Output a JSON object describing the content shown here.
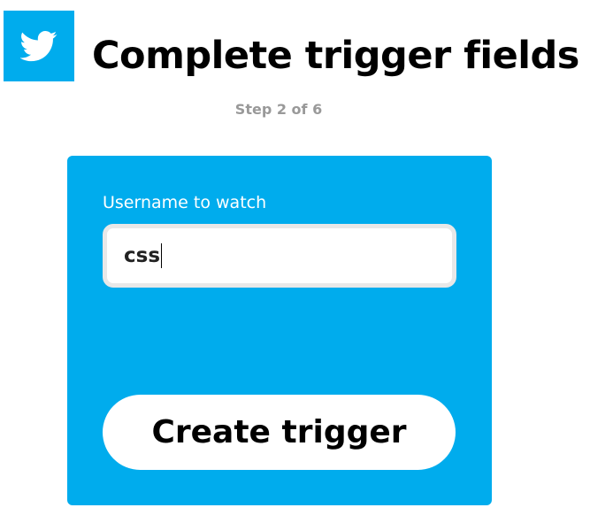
{
  "header": {
    "service_icon": "twitter-bird-icon",
    "title": "Complete trigger fields",
    "step": "Step 2 of 6"
  },
  "form": {
    "field_label": "Username to watch",
    "field_value": "css",
    "submit_label": "Create trigger"
  },
  "colors": {
    "brand": "#00aced",
    "card_background": "#00aced",
    "step_text": "#999999",
    "button_background": "#ffffff"
  }
}
